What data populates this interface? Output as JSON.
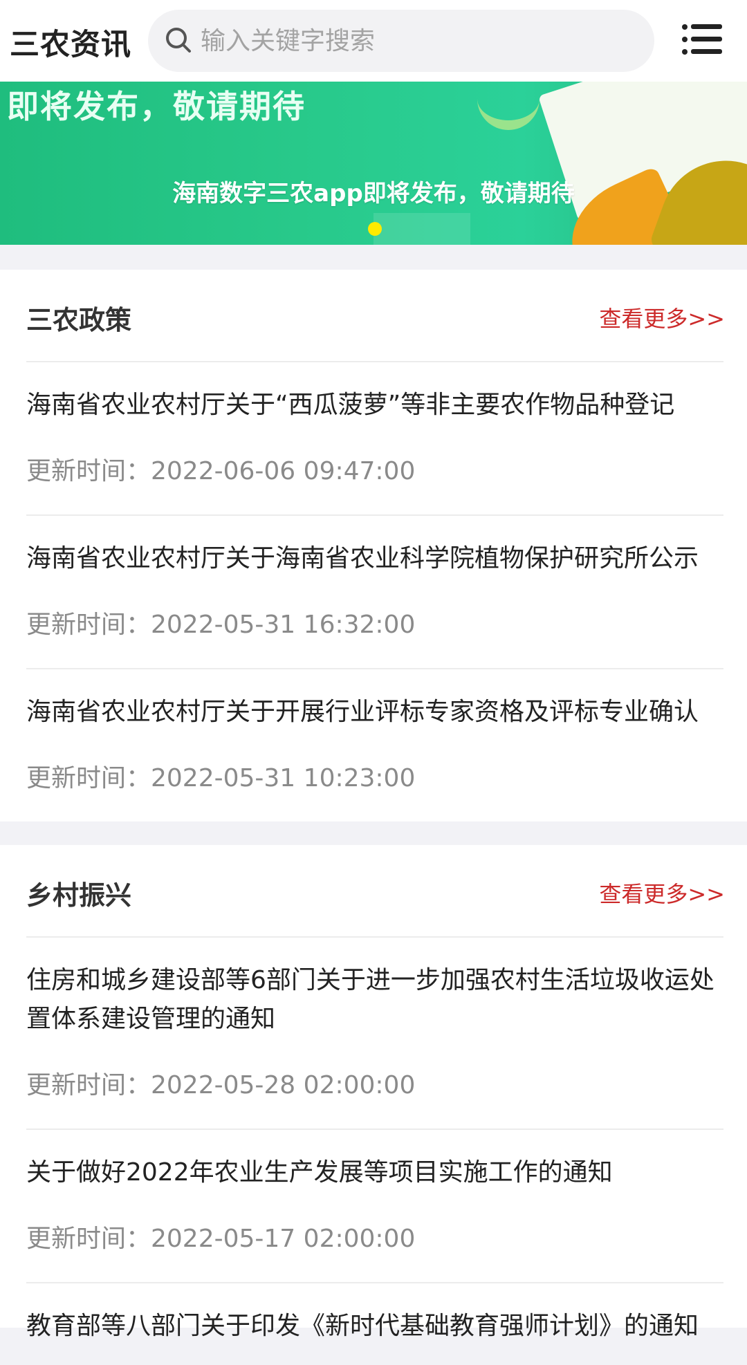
{
  "header": {
    "title": "三农资讯",
    "search_placeholder": "输入关键字搜索"
  },
  "banner": {
    "headline": "即将发布，敬请期待",
    "caption": "海南数字三农app即将发布，敬请期待",
    "slide_count": 1,
    "active_slide": 1
  },
  "sections": [
    {
      "title": "三农政策",
      "more_label": "查看更多>>",
      "items": [
        {
          "title": "海南省农业农村厅关于“西瓜菠萝”等非主要农作物品种登记",
          "time": "更新时间：2022-06-06 09:47:00"
        },
        {
          "title": "海南省农业农村厅关于海南省农业科学院植物保护研究所公示",
          "time": "更新时间：2022-05-31 16:32:00"
        },
        {
          "title": "海南省农业农村厅关于开展行业评标专家资格及评标专业确认",
          "time": "更新时间：2022-05-31 10:23:00"
        }
      ]
    },
    {
      "title": "乡村振兴",
      "more_label": "查看更多>>",
      "items": [
        {
          "title": "住房和城乡建设部等6部门关于进一步加强农村生活垃圾收运处置体系建设管理的通知",
          "time": "更新时间：2022-05-28 02:00:00"
        },
        {
          "title": "关于做好2022年农业生产发展等项目实施工作的通知",
          "time": "更新时间：2022-05-17 02:00:00"
        },
        {
          "title": "教育部等八部门关于印发《新时代基础教育强师计划》的通知",
          "time": ""
        }
      ]
    }
  ],
  "colors": {
    "accent_red": "#cc2a2a",
    "banner_green": "#28c98a",
    "dot_yellow": "#ffeb00"
  }
}
